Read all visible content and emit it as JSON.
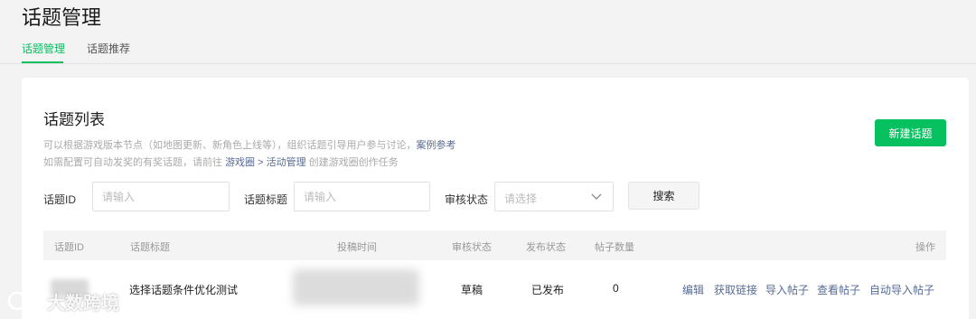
{
  "page": {
    "title": "话题管理"
  },
  "tabs": [
    {
      "label": "话题管理",
      "active": true
    },
    {
      "label": "话题推荐",
      "active": false
    }
  ],
  "card": {
    "title": "话题列表",
    "desc_line1_text": "可以根据游戏版本节点（如地图更新、新角色上线等），组织话题引导用户参与讨论，",
    "desc_line1_link": "案例参考",
    "desc_line2_prefix": "如需配置可自动发奖的有奖话题，请前往",
    "desc_line2_link": "游戏圈 > 活动管理",
    "desc_line2_suffix": "创建游戏圈创作任务",
    "new_button": "新建话题"
  },
  "filters": {
    "id_label": "话题ID",
    "id_placeholder": "请输入",
    "title_label": "话题标题",
    "title_placeholder": "请输入",
    "status_label": "审核状态",
    "status_placeholder": "请选择",
    "search_button": "搜索"
  },
  "table": {
    "headers": [
      "话题ID",
      "话题标题",
      "投稿时间",
      "审核状态",
      "发布状态",
      "帖子数量",
      "操作"
    ],
    "rows": [
      {
        "title": "选择话题条件优化测试",
        "review_status": "草稿",
        "publish_status": "已发布",
        "post_count": "0",
        "actions": [
          "编辑",
          "获取链接",
          "导入帖子",
          "查看帖子",
          "自动导入帖子"
        ]
      }
    ]
  },
  "watermark": {
    "text": "大数跨境",
    "icon": "watermark-logo-icon"
  },
  "colors": {
    "accent": "#07c160",
    "link": "#576b95"
  }
}
